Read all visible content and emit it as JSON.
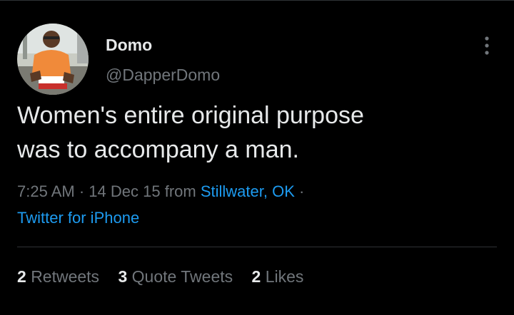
{
  "author": {
    "display_name": "Domo",
    "handle": "@DapperDomo"
  },
  "more_icon": "more-vertical-icon",
  "tweet": {
    "text_line_1": "Women's entire original purpose",
    "text_line_2": "was to accompany a man."
  },
  "meta": {
    "time": "7:25 AM",
    "separator": "·",
    "date": "14 Dec 15",
    "from_label": "from",
    "location": "Stillwater, OK",
    "source": "Twitter for iPhone"
  },
  "stats": {
    "retweets_count": "2",
    "retweets_label": "Retweets",
    "quote_count": "3",
    "quote_label": "Quote Tweets",
    "likes_count": "2",
    "likes_label": "Likes"
  },
  "colors": {
    "background": "#000000",
    "primary_text": "#e7e9ea",
    "secondary_text": "#71767b",
    "link": "#1d9bf0",
    "divider": "#2f3336"
  }
}
